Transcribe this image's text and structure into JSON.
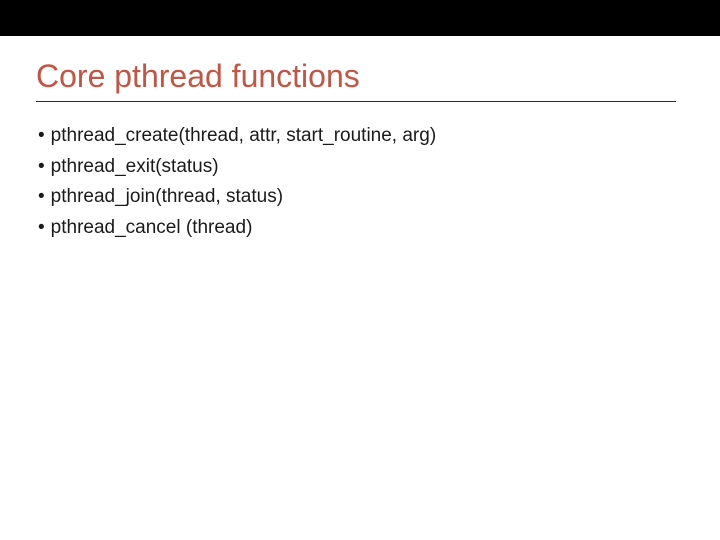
{
  "title": "Core pthread functions",
  "bullets": [
    "pthread_create(thread, attr, start_routine, arg)",
    "pthread_exit(status)",
    "pthread_join(thread, status)",
    "pthread_cancel (thread)"
  ]
}
